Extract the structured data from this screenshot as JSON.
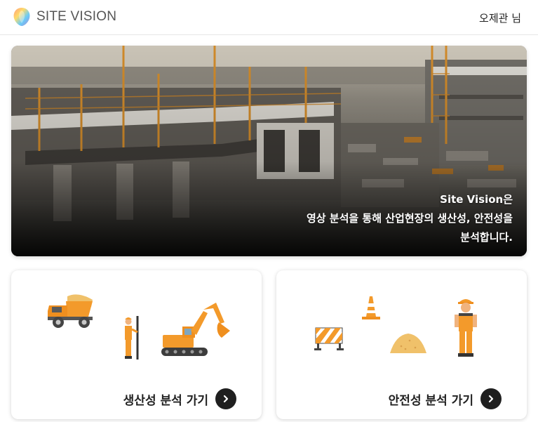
{
  "header": {
    "logo_text": "SITE VISION",
    "user_label": "오제관 님"
  },
  "hero": {
    "line1": "Site Vision은",
    "line2": "영상 분석을 통해 산업현장의 생산성, 안전성을",
    "line3": "분석합니다."
  },
  "cards": [
    {
      "label": "생산성 분석 가기",
      "icon": "chevron-right-icon"
    },
    {
      "label": "안전성 분석 가기",
      "icon": "chevron-right-icon"
    }
  ],
  "colors": {
    "accent_orange": "#f39a2b",
    "dark_button": "#1f1f1f",
    "border": "#e6e6e6"
  }
}
